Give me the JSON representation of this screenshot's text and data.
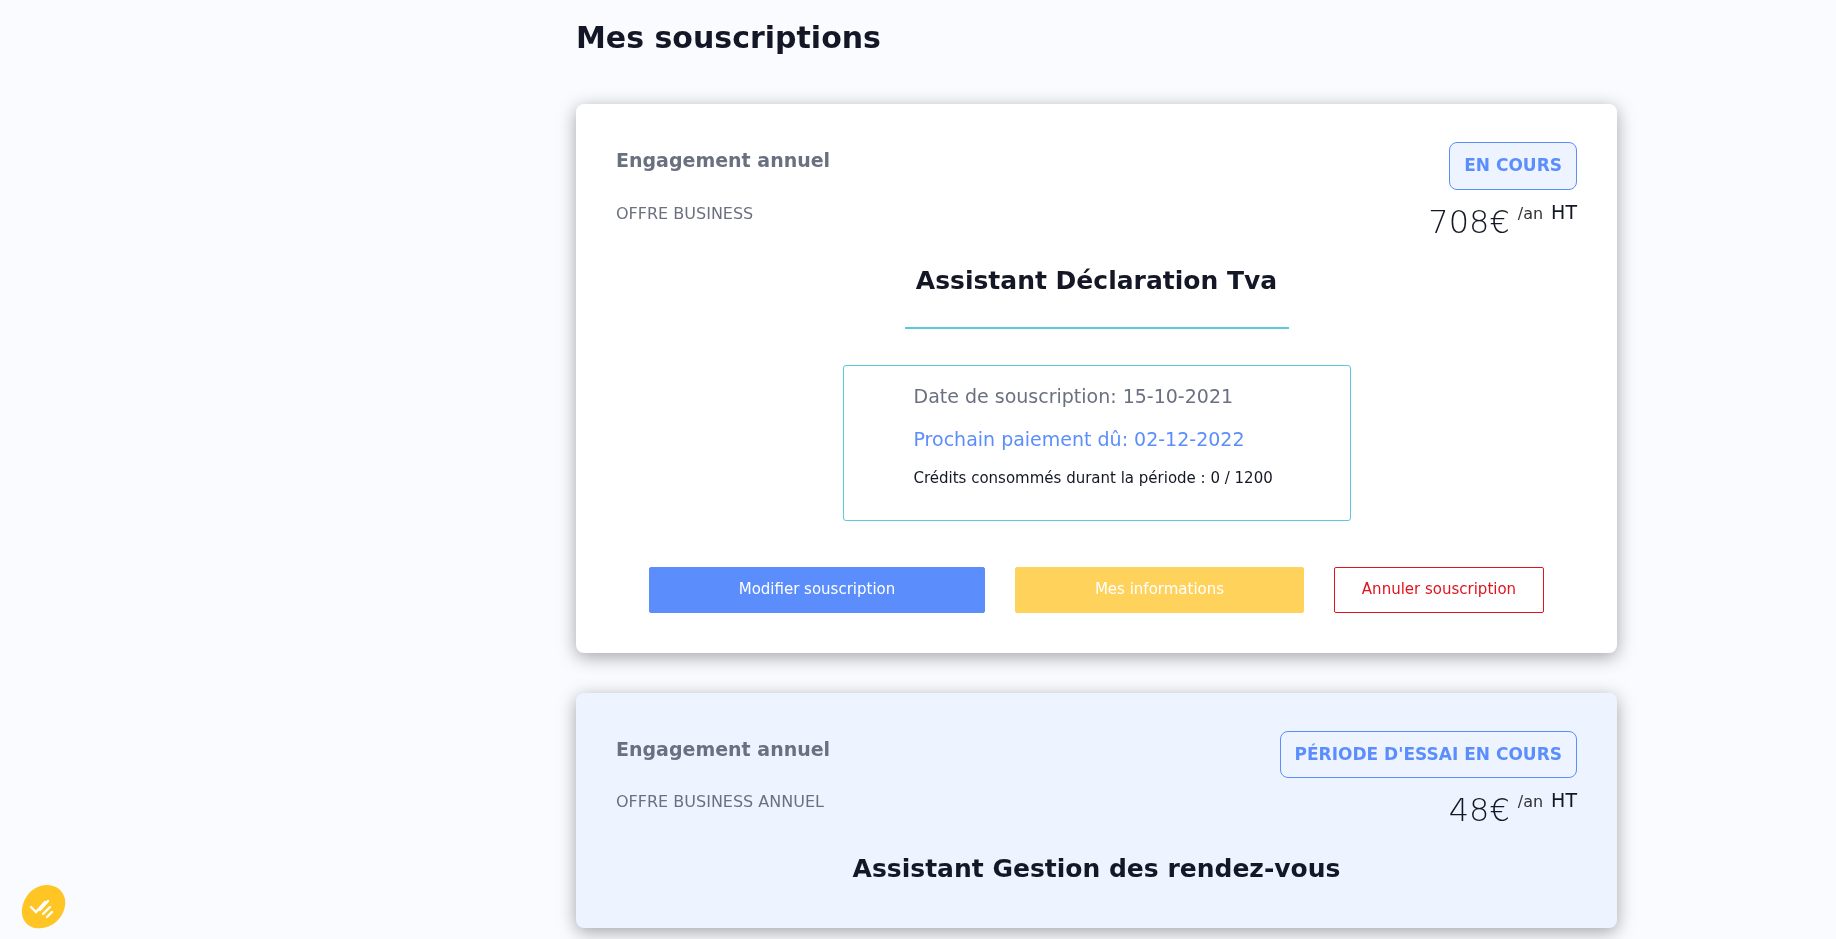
{
  "page_title": "Mes souscriptions",
  "subscriptions": [
    {
      "kind": "active",
      "commitment": "Engagement annuel",
      "status": "EN COURS",
      "offer": "OFFRE BUSINESS",
      "price": "708€",
      "period": "/an",
      "tax": "HT",
      "product": "Assistant Déclaration Tva",
      "subscription_date": "Date de souscription: 15-10-2021",
      "next_payment": "Prochain paiement dû: 02-12-2022",
      "credits": "Crédits consommés durant la période : 0 / 1200",
      "buttons": [
        {
          "kind": "primary",
          "label": "Modifier souscription"
        },
        {
          "kind": "warning",
          "label": "Mes informations"
        },
        {
          "kind": "danger",
          "label": "Annuler souscription"
        }
      ]
    },
    {
      "kind": "trial",
      "commitment": "Engagement annuel",
      "status": "PÉRIODE D'ESSAI EN COURS",
      "offer": "OFFRE BUSINESS ANNUEL",
      "price": "48€",
      "period": "/an",
      "tax": "HT",
      "product": "Assistant Gestion des rendez-vous"
    }
  ]
}
